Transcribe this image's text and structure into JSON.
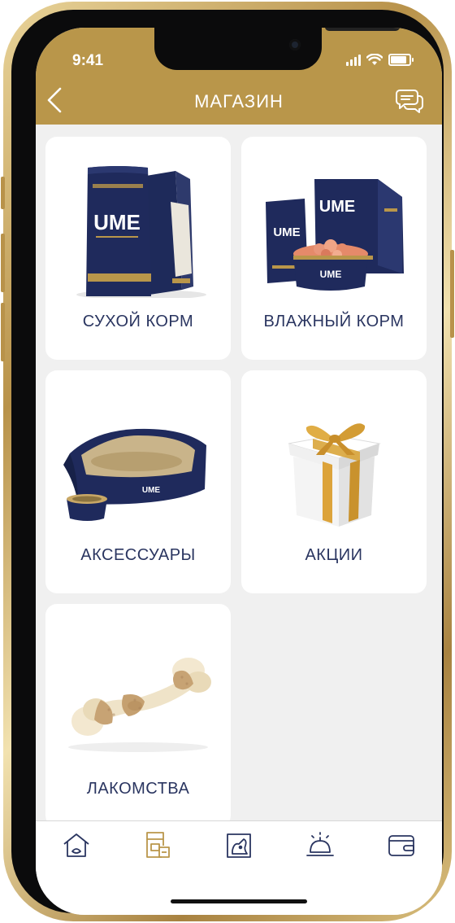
{
  "status_bar": {
    "time": "9:41"
  },
  "header": {
    "title": "МАГАЗИН"
  },
  "categories": [
    {
      "label": "СУХОЙ КОРМ",
      "icon": "dry-food-bags-image"
    },
    {
      "label": "ВЛАЖНЫЙ КОРМ",
      "icon": "wet-food-pack-image"
    },
    {
      "label": "АКСЕССУАРЫ",
      "icon": "pet-bed-and-bowl-image"
    },
    {
      "label": "АКЦИИ",
      "icon": "gift-box-image"
    },
    {
      "label": "ЛАКОМСТВА",
      "icon": "chew-bone-image"
    }
  ],
  "product_brand": "UME",
  "tabbar": {
    "items": [
      {
        "name": "home-tab",
        "icon": "home-icon",
        "active": false
      },
      {
        "name": "shop-tab",
        "icon": "shop-icon",
        "active": true
      },
      {
        "name": "pets-tab",
        "icon": "pet-profile-icon",
        "active": false
      },
      {
        "name": "services-tab",
        "icon": "service-bell-icon",
        "active": false
      },
      {
        "name": "wallet-tab",
        "icon": "wallet-icon",
        "active": false
      }
    ]
  },
  "colors": {
    "accent": "#b9964a",
    "text": "#2a3560",
    "navy": "#1f2a5c",
    "background": "#f0f0f0"
  }
}
